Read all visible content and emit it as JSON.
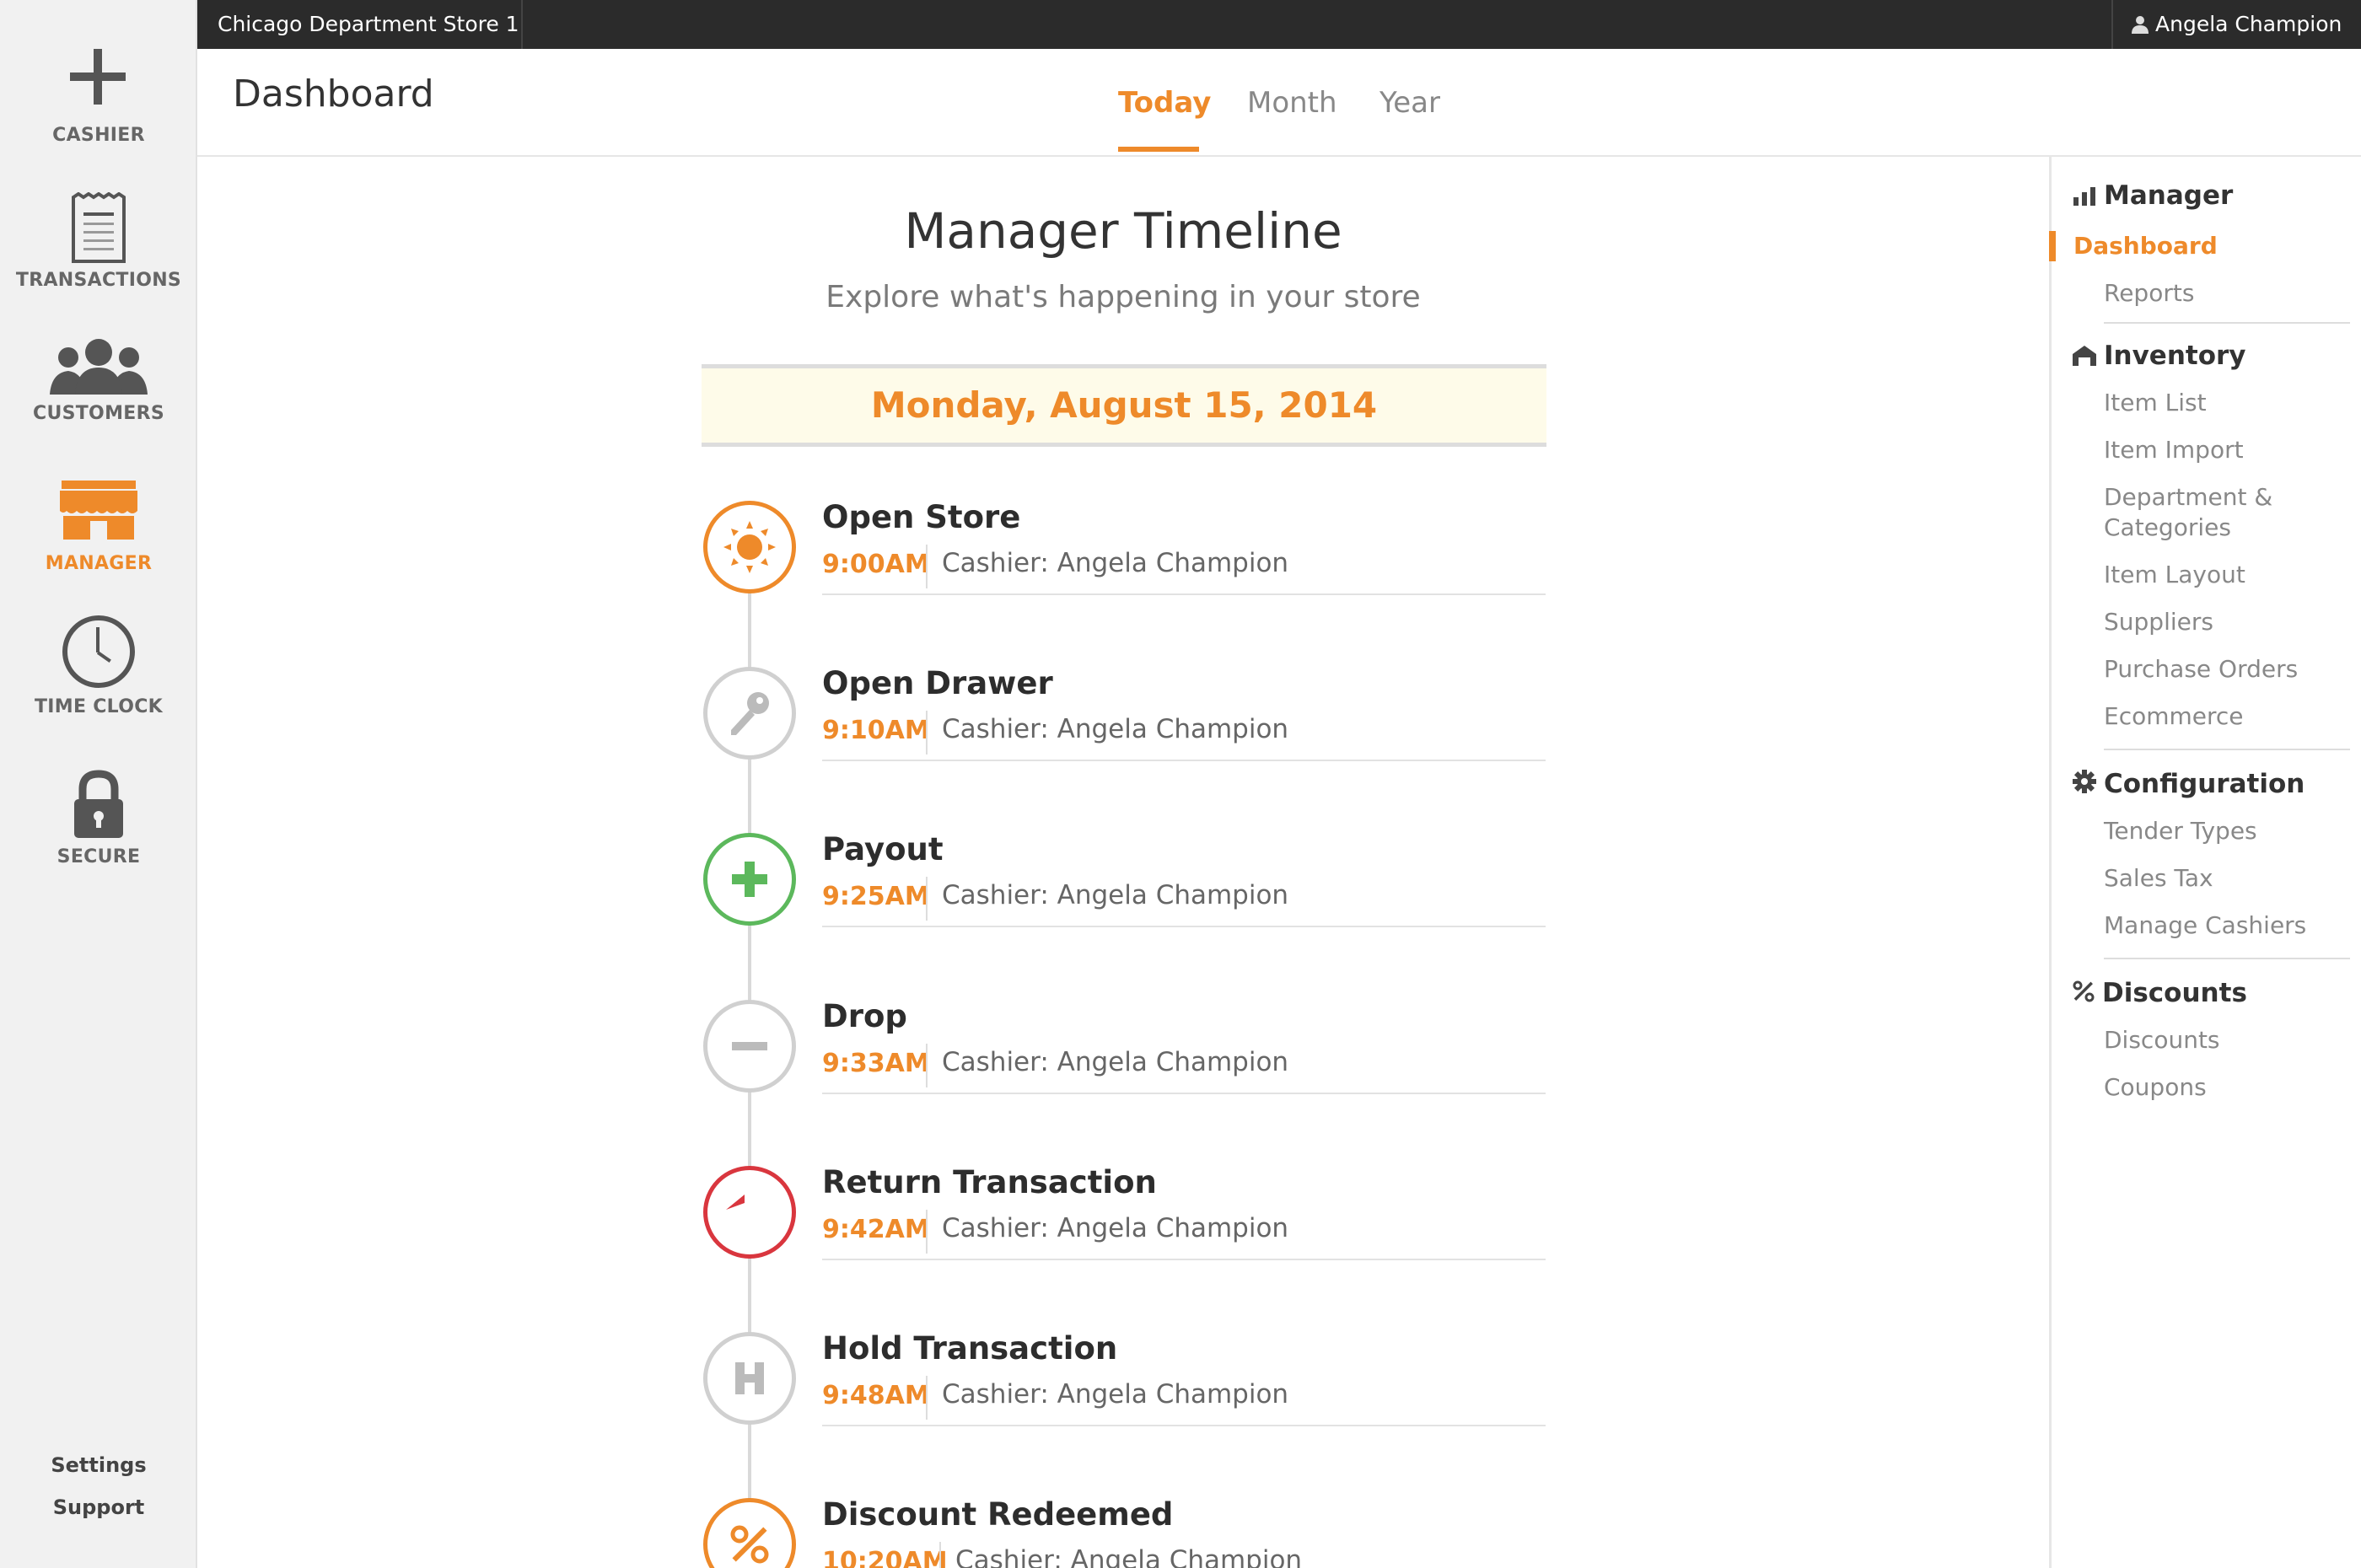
{
  "topbar": {
    "store": "Chicago Department Store 1",
    "user": "Angela Champion"
  },
  "leftnav": {
    "items": [
      {
        "label": "CASHIER",
        "icon": "plus-icon"
      },
      {
        "label": "TRANSACTIONS",
        "icon": "receipt-icon"
      },
      {
        "label": "CUSTOMERS",
        "icon": "people-icon"
      },
      {
        "label": "MANAGER",
        "icon": "storefront-icon",
        "active": true
      },
      {
        "label": "TIME CLOCK",
        "icon": "clock-icon"
      },
      {
        "label": "SECURE",
        "icon": "lock-icon"
      }
    ],
    "settings": "Settings",
    "support": "Support"
  },
  "header": {
    "title": "Dashboard",
    "tabs": [
      {
        "label": "Today",
        "active": true
      },
      {
        "label": "Month"
      },
      {
        "label": "Year"
      }
    ]
  },
  "main": {
    "title": "Manager Timeline",
    "subtitle": "Explore what's happening in your store",
    "date": "Monday, August 15, 2014",
    "events": [
      {
        "title": "Open Store",
        "time": "9:00AM",
        "cashier": "Cashier: Angela Champion",
        "icon": "sun-icon",
        "color": "#ee8a2a"
      },
      {
        "title": "Open Drawer",
        "time": "9:10AM",
        "cashier": "Cashier: Angela Champion",
        "icon": "key-icon",
        "color": "#cccccc"
      },
      {
        "title": "Payout",
        "time": "9:25AM",
        "cashier": "Cashier: Angela Champion",
        "icon": "plus-icon",
        "color": "#5cb85c"
      },
      {
        "title": "Drop",
        "time": "9:33AM",
        "cashier": "Cashier: Angela Champion",
        "icon": "minus-icon",
        "color": "#cccccc"
      },
      {
        "title": "Return Transaction",
        "time": "9:42AM",
        "cashier": "Cashier: Angela Champion",
        "icon": "reply-icon",
        "color": "#d9363e"
      },
      {
        "title": "Hold Transaction",
        "time": "9:48AM",
        "cashier": "Cashier: Angela Champion",
        "icon": "h-icon",
        "color": "#cccccc"
      },
      {
        "title": "Discount Redeemed",
        "time": "10:20AM",
        "cashier": "Cashier: Angela Champion",
        "icon": "percent-icon",
        "color": "#ee8a2a"
      }
    ]
  },
  "rightside": {
    "sections": [
      {
        "heading": "Manager",
        "icon": "bar-chart-icon",
        "items": [
          "Dashboard",
          "Reports"
        ]
      },
      {
        "heading": "Inventory",
        "icon": "warehouse-icon",
        "items": [
          "Item List",
          "Item Import",
          "Department &",
          "Categories",
          "Item Layout",
          "Suppliers",
          "Purchase Orders",
          "Ecommerce"
        ]
      },
      {
        "heading": "Configuration",
        "icon": "gear-icon",
        "items": [
          "Tender Types",
          "Sales Tax",
          "Manage Cashiers"
        ]
      },
      {
        "heading": "Discounts",
        "icon": "percent-icon",
        "items": [
          "Discounts",
          "Coupons"
        ]
      }
    ],
    "active_item": "Dashboard",
    "accent": "#ee8a2a"
  }
}
